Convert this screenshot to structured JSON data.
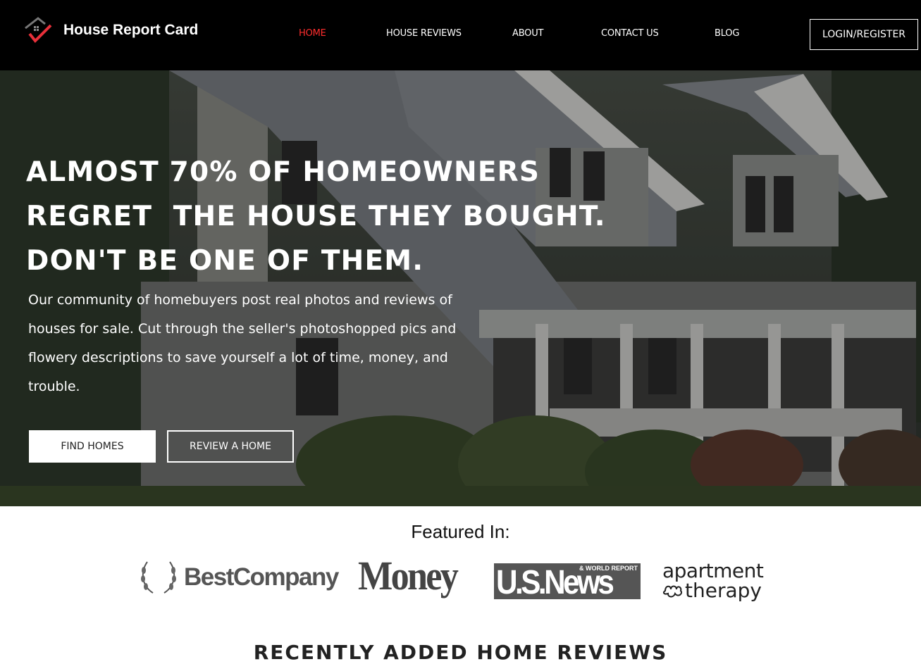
{
  "header": {
    "site_title": "House Report Card",
    "logo_icon": "house-check-icon",
    "nav": [
      {
        "label": "HOME",
        "active": true
      },
      {
        "label": "HOUSE REVIEWS",
        "active": false
      },
      {
        "label": "ABOUT",
        "active": false
      },
      {
        "label": "CONTACT US",
        "active": false
      },
      {
        "label": "BLOG",
        "active": false
      }
    ],
    "login_label": "LOGIN/REGISTER"
  },
  "hero": {
    "headline_lines": [
      "ALMOST 70% OF HOMEOWNERS",
      "REGRET  THE HOUSE THEY BOUGHT.",
      "DON'T BE ONE OF THEM."
    ],
    "subtext": "Our community of homebuyers post real photos and reviews of houses for sale. Cut through the seller's photoshopped pics and flowery descriptions to save yourself a lot of time, money, and trouble.",
    "primary_button": "FIND HOMES",
    "secondary_button": "REVIEW A HOME"
  },
  "featured": {
    "title": "Featured In:",
    "logos": {
      "best_company": "BestCompany",
      "money": "Money",
      "usnews_small": "& WORLD REPORT",
      "usnews_main": "U.S.News",
      "apartment_line1": "apartment",
      "apartment_line2": "therapy"
    }
  },
  "next_section": {
    "title": "RECENTLY ADDED HOME REVIEWS"
  },
  "colors": {
    "header_bg": "#000000",
    "accent_red": "#ff2d2d",
    "text_white": "#ffffff"
  }
}
